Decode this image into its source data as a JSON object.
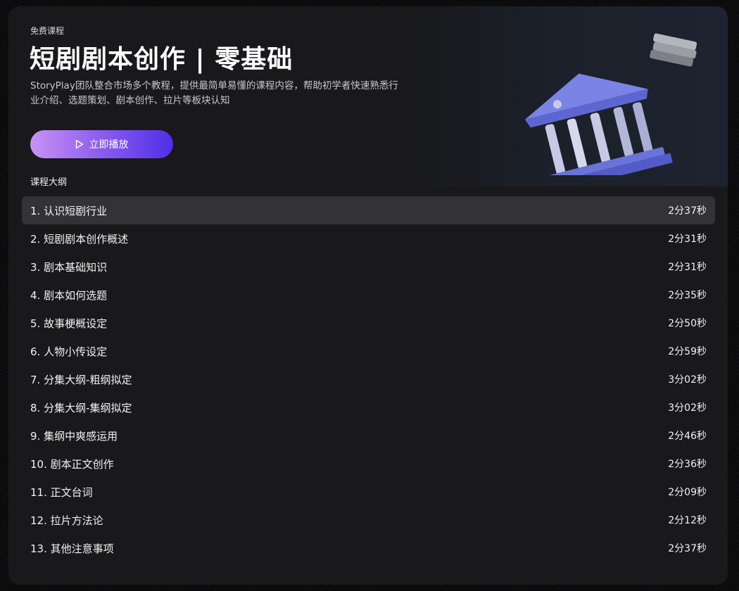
{
  "hero": {
    "eyebrow": "免费课程",
    "title": "短剧剧本创作 | 零基础",
    "description": "StoryPlay团队整合市场多个教程，提供最简单易懂的课程内容，帮助初学者快速熟悉行业介绍、选题策划、剧本创作、拉片等板块认知",
    "play_label": "立即播放",
    "play_icon": "play-triangle-icon",
    "illustration": "bank-building-3d-icon",
    "accent_colors": [
      "#c892f4",
      "#8b5cf0",
      "#4f2ee8"
    ]
  },
  "outline": {
    "heading": "课程大纲",
    "active_index": 0,
    "lessons": [
      {
        "title": "1. 认识短剧行业",
        "duration": "2分37秒"
      },
      {
        "title": "2. 短剧剧本创作概述",
        "duration": "2分31秒"
      },
      {
        "title": "3. 剧本基础知识",
        "duration": "2分31秒"
      },
      {
        "title": "4. 剧本如何选题",
        "duration": "2分35秒"
      },
      {
        "title": "5. 故事梗概设定",
        "duration": "2分50秒"
      },
      {
        "title": "6. 人物小传设定",
        "duration": "2分59秒"
      },
      {
        "title": "7. 分集大纲-粗纲拟定",
        "duration": "3分02秒"
      },
      {
        "title": "8. 分集大纲-集纲拟定",
        "duration": "3分02秒"
      },
      {
        "title": "9. 集纲中爽感运用",
        "duration": "2分46秒"
      },
      {
        "title": "10. 剧本正文创作",
        "duration": "2分36秒"
      },
      {
        "title": "11. 正文台词",
        "duration": "2分09秒"
      },
      {
        "title": "12. 拉片方法论",
        "duration": "2分12秒"
      },
      {
        "title": "13. 其他注意事项",
        "duration": "2分37秒"
      }
    ]
  }
}
